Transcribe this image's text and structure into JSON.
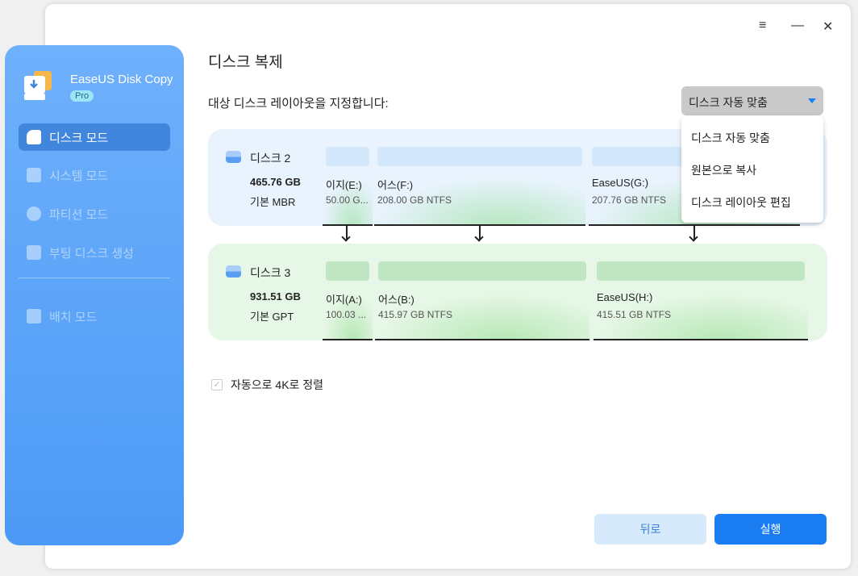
{
  "window": {
    "menu_icon": "≡",
    "minimize_icon": "—",
    "close_icon": "✕"
  },
  "sidebar": {
    "app_name": "EaseUS Disk Copy",
    "badge": "Pro",
    "items": [
      {
        "label": "디스크 모드"
      },
      {
        "label": "시스템 모드"
      },
      {
        "label": "파티션 모드"
      },
      {
        "label": "부팅 디스크 생성"
      },
      {
        "label": "배치 모드"
      }
    ]
  },
  "main": {
    "title": "디스크 복제",
    "layout_label": "대상 디스크 레이아웃을 지정합니다:",
    "dropdown": {
      "selected": "디스크 자동 맞춤",
      "options": [
        "디스크 자동 맞춤",
        "원본으로 복사",
        "디스크 레이아웃 편집"
      ]
    },
    "source": {
      "name": "디스크 2",
      "size": "465.76 GB",
      "type": "기본 MBR",
      "partitions": [
        {
          "name": "이지(E:)",
          "info": "50.00 G..."
        },
        {
          "name": "어스(F:)",
          "info": "208.00 GB NTFS"
        },
        {
          "name": "EaseUS(G:)",
          "info": "207.76 GB NTFS"
        }
      ]
    },
    "target": {
      "name": "디스크 3",
      "size": "931.51 GB",
      "type": "기본 GPT",
      "partitions": [
        {
          "name": "이지(A:)",
          "info": "100.03 ..."
        },
        {
          "name": "어스(B:)",
          "info": "415.97 GB NTFS"
        },
        {
          "name": "EaseUS(H:)",
          "info": "415.51 GB NTFS"
        }
      ]
    },
    "align_4k": {
      "label": "자동으로 4K로 정렬",
      "checked": true
    },
    "back_label": "뒤로",
    "run_label": "실행"
  },
  "colors": {
    "accent": "#1a7ef2",
    "sidebar": "#5ea5f8"
  }
}
